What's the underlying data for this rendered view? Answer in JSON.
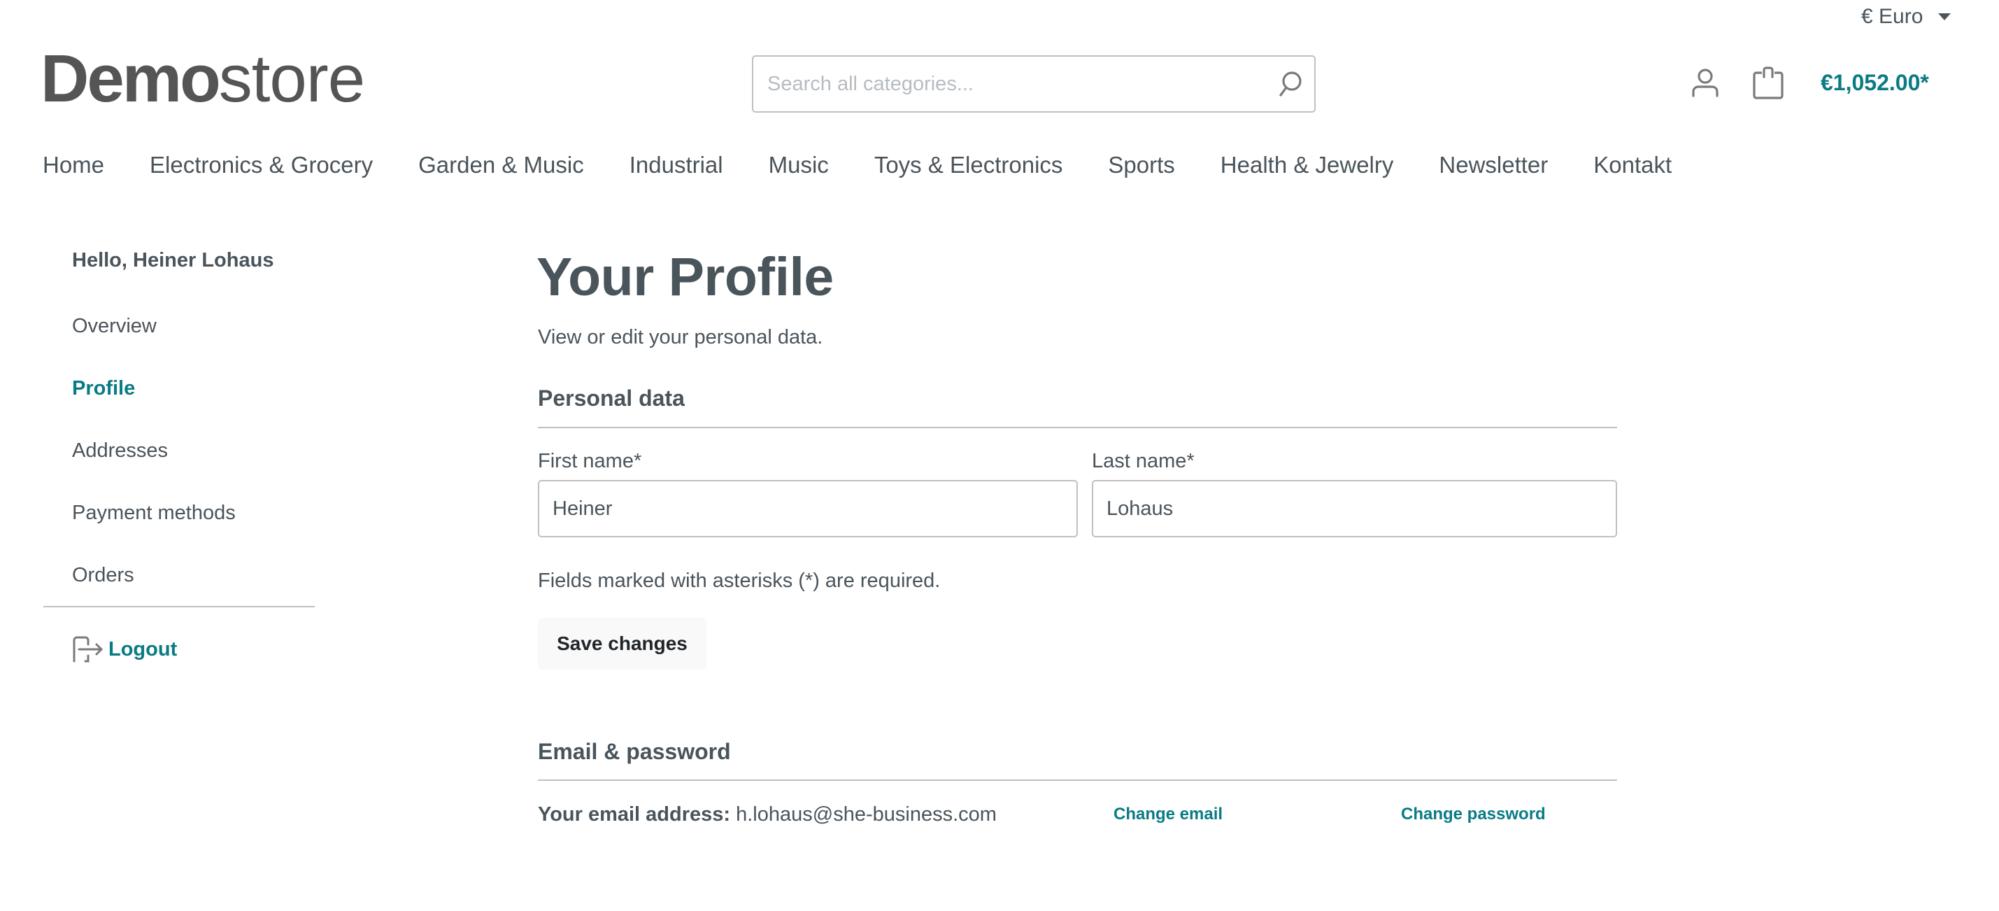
{
  "header": {
    "currency": {
      "symbol": "€",
      "label": "€ Euro"
    },
    "logo": {
      "bold": "Demo",
      "light": "store"
    },
    "search": {
      "placeholder": "Search all categories...",
      "value": ""
    },
    "cart": {
      "total": "€1,052.00*"
    },
    "icons": {
      "search": "search-icon",
      "account": "user-icon",
      "cart": "shopping-bag-icon",
      "currency_caret": "caret-down-icon"
    }
  },
  "nav": {
    "items": [
      {
        "label": "Home"
      },
      {
        "label": "Electronics & Grocery"
      },
      {
        "label": "Garden & Music"
      },
      {
        "label": "Industrial"
      },
      {
        "label": "Music"
      },
      {
        "label": "Toys & Electronics"
      },
      {
        "label": "Sports"
      },
      {
        "label": "Health & Jewelry"
      },
      {
        "label": "Newsletter"
      },
      {
        "label": "Kontakt"
      }
    ]
  },
  "sidebar": {
    "greeting": "Hello, Heiner Lohaus",
    "items": [
      {
        "label": "Overview",
        "active": false
      },
      {
        "label": "Profile",
        "active": true
      },
      {
        "label": "Addresses",
        "active": false
      },
      {
        "label": "Payment methods",
        "active": false
      },
      {
        "label": "Orders",
        "active": false
      }
    ],
    "logout": {
      "label": "Logout",
      "icon": "logout-icon"
    }
  },
  "main": {
    "title": "Your Profile",
    "subtitle": "View or edit your personal data.",
    "personal": {
      "heading": "Personal data",
      "first_name": {
        "label": "First name*",
        "value": "Heiner"
      },
      "last_name": {
        "label": "Last name*",
        "value": "Lohaus"
      },
      "required_note": "Fields marked with asterisks (*) are required.",
      "save_label": "Save changes"
    },
    "email_password": {
      "heading": "Email & password",
      "email_label": "Your email address:",
      "email_value": "h.lohaus@she-business.com",
      "change_email": "Change email",
      "change_password": "Change password"
    }
  },
  "colors": {
    "primary": "#0a7b85",
    "text": "#4a545b",
    "border": "#bcc1c7",
    "logo": "#555555",
    "button_bg": "#f9f9f9"
  }
}
